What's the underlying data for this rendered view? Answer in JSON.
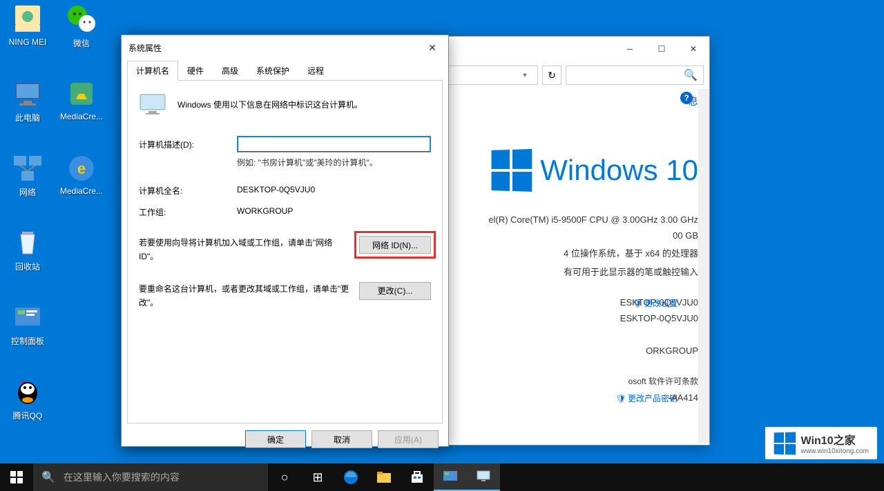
{
  "desktop_icons": [
    {
      "label": "NING MEI"
    },
    {
      "label": "微信"
    },
    {
      "label": "此电脑"
    },
    {
      "label": "MediaCre..."
    },
    {
      "label": "网络"
    },
    {
      "label": "MediaCre..."
    },
    {
      "label": "回收站"
    },
    {
      "label": "控制面板"
    },
    {
      "label": "腾讯QQ"
    }
  ],
  "dialog": {
    "title": "系统属性",
    "tabs": [
      "计算机名",
      "硬件",
      "高级",
      "系统保护",
      "远程"
    ],
    "intro": "Windows 使用以下信息在网络中标识这台计算机。",
    "desc_label": "计算机描述(D):",
    "desc_value": "",
    "desc_hint": "例如: \"书房计算机\"或\"美玲的计算机\"。",
    "fullname_label": "计算机全名:",
    "fullname_value": "DESKTOP-0Q5VJU0",
    "workgroup_label": "工作组:",
    "workgroup_value": "WORKGROUP",
    "netid_text": "若要使用向导将计算机加入域或工作组，请单击\"网络 ID\"。",
    "netid_btn": "网络 ID(N)...",
    "change_text": "要重命名这台计算机，或者更改其域或工作组，请单击\"更改\"。",
    "change_btn": "更改(C)...",
    "ok": "确定",
    "cancel": "取消",
    "apply": "应用(A)"
  },
  "system_window": {
    "link_basic": "息",
    "cpu": "el(R) Core(TM) i5-9500F CPU @ 3.00GHz   3.00 GHz",
    "ram": "00 GB",
    "arch": "4 位操作系统，基于 x64 的处理器",
    "touch": "有可用于此显示器的笔或触控输入",
    "pcname": "ESKTOP-0Q5VJU0",
    "pcfull": "ESKTOP-0Q5VJU0",
    "workgroup": "ORKGROUP",
    "change_settings": "更改设置",
    "license": "osoft 软件许可条款",
    "productid": "-AA414",
    "change_key": "更改产品密钥",
    "win10": "Windows 10"
  },
  "taskbar": {
    "search_placeholder": "在这里输入你要搜索的内容"
  },
  "watermark": {
    "big": "Win10之家",
    "small": "www.win10xitong.com"
  }
}
